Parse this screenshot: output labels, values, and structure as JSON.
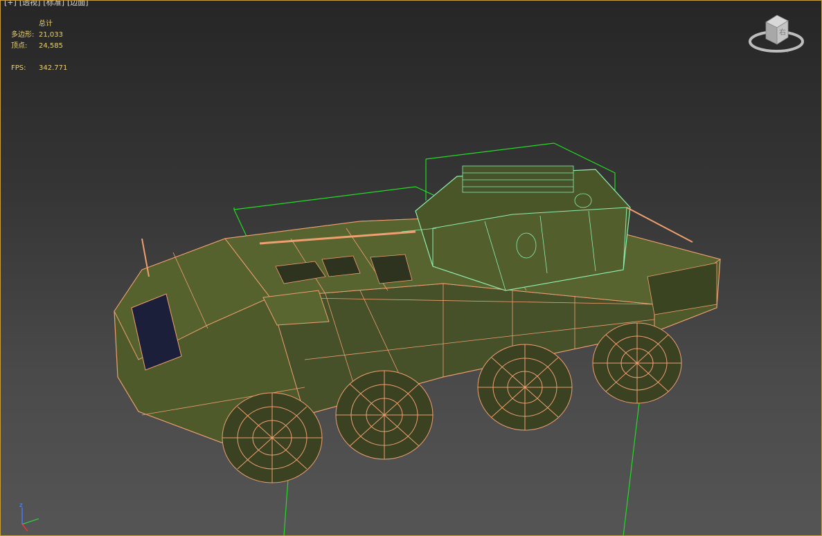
{
  "viewport": {
    "menu_plus": "[+]",
    "menu_view": "[透视]",
    "menu_shading_std": "[标准]",
    "menu_shading_mode": "[边面]"
  },
  "stats": {
    "header": "总计",
    "polygons_label": "多边形:",
    "polygons_value": "21,033",
    "vertices_label": "顶点:",
    "vertices_value": "24,585",
    "fps_label": "FPS:",
    "fps_value": "342.771"
  },
  "viewcube": {
    "face_label": "右"
  },
  "tripod": {
    "z_label": "z"
  },
  "colors": {
    "hull": "#4e5a2a",
    "hull_dark": "#3e4822",
    "wire_orange": "#f0a070",
    "wire_green": "#8ff0b0",
    "bbox_green": "#22dd22",
    "stats_text": "#e8d27a",
    "border": "#c8a040"
  }
}
